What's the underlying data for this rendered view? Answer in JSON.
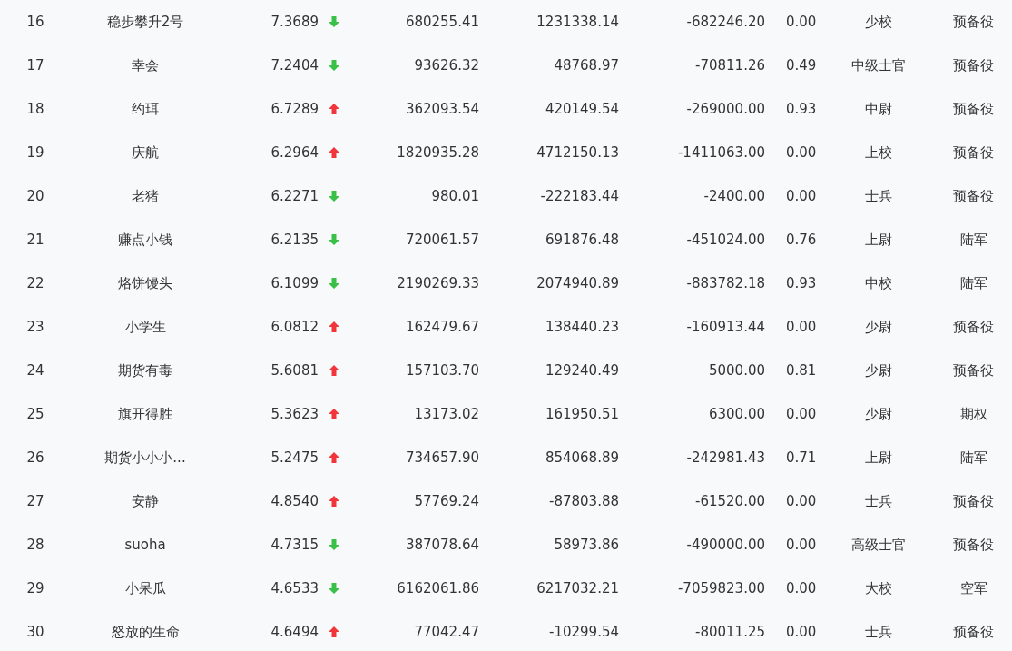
{
  "rows": [
    {
      "rank": "16",
      "name": "稳步攀升2号",
      "score": "7.3689",
      "rising": false,
      "column_4": "680255.41",
      "column_5": "1231338.14",
      "column_6": "-682246.20",
      "column_7": "0.00",
      "title": "少校",
      "group": "预备役"
    },
    {
      "rank": "17",
      "name": "幸会",
      "score": "7.2404",
      "rising": false,
      "column_4": "93626.32",
      "column_5": "48768.97",
      "column_6": "-70811.26",
      "column_7": "0.49",
      "title": "中级士官",
      "group": "预备役"
    },
    {
      "rank": "18",
      "name": "约珥",
      "score": "6.7289",
      "rising": true,
      "column_4": "362093.54",
      "column_5": "420149.54",
      "column_6": "-269000.00",
      "column_7": "0.93",
      "title": "中尉",
      "group": "预备役"
    },
    {
      "rank": "19",
      "name": "庆航",
      "score": "6.2964",
      "rising": true,
      "column_4": "1820935.28",
      "column_5": "4712150.13",
      "column_6": "-1411063.00",
      "column_7": "0.00",
      "title": "上校",
      "group": "预备役"
    },
    {
      "rank": "20",
      "name": "老猪",
      "score": "6.2271",
      "rising": false,
      "column_4": "980.01",
      "column_5": "-222183.44",
      "column_6": "-2400.00",
      "column_7": "0.00",
      "title": "士兵",
      "group": "预备役"
    },
    {
      "rank": "21",
      "name": "赚点小钱",
      "score": "6.2135",
      "rising": false,
      "column_4": "720061.57",
      "column_5": "691876.48",
      "column_6": "-451024.00",
      "column_7": "0.76",
      "title": "上尉",
      "group": "陆军"
    },
    {
      "rank": "22",
      "name": "烙饼馒头",
      "score": "6.1099",
      "rising": false,
      "column_4": "2190269.33",
      "column_5": "2074940.89",
      "column_6": "-883782.18",
      "column_7": "0.93",
      "title": "中校",
      "group": "陆军"
    },
    {
      "rank": "23",
      "name": "小学生",
      "score": "6.0812",
      "rising": true,
      "column_4": "162479.67",
      "column_5": "138440.23",
      "column_6": "-160913.44",
      "column_7": "0.00",
      "title": "少尉",
      "group": "预备役"
    },
    {
      "rank": "24",
      "name": "期货有毒",
      "score": "5.6081",
      "rising": true,
      "column_4": "157103.70",
      "column_5": "129240.49",
      "column_6": "5000.00",
      "column_7": "0.81",
      "title": "少尉",
      "group": "预备役"
    },
    {
      "rank": "25",
      "name": "旗开得胜",
      "score": "5.3623",
      "rising": true,
      "column_4": "13173.02",
      "column_5": "161950.51",
      "column_6": "6300.00",
      "column_7": "0.00",
      "title": "少尉",
      "group": "期权"
    },
    {
      "rank": "26",
      "name": "期货小小小...",
      "score": "5.2475",
      "rising": true,
      "column_4": "734657.90",
      "column_5": "854068.89",
      "column_6": "-242981.43",
      "column_7": "0.71",
      "title": "上尉",
      "group": "陆军"
    },
    {
      "rank": "27",
      "name": "安静",
      "score": "4.8540",
      "rising": true,
      "column_4": "57769.24",
      "column_5": "-87803.88",
      "column_6": "-61520.00",
      "column_7": "0.00",
      "title": "士兵",
      "group": "预备役"
    },
    {
      "rank": "28",
      "name": "suoha",
      "score": "4.7315",
      "rising": false,
      "column_4": "387078.64",
      "column_5": "58973.86",
      "column_6": "-490000.00",
      "column_7": "0.00",
      "title": "高级士官",
      "group": "预备役"
    },
    {
      "rank": "29",
      "name": "小呆瓜",
      "score": "4.6533",
      "rising": false,
      "column_4": "6162061.86",
      "column_5": "6217032.21",
      "column_6": "-7059823.00",
      "column_7": "0.00",
      "title": "大校",
      "group": "空军"
    },
    {
      "rank": "30",
      "name": "怒放的生命",
      "score": "4.6494",
      "rising": true,
      "column_4": "77042.47",
      "column_5": "-10299.54",
      "column_6": "-80011.25",
      "column_7": "0.00",
      "title": "士兵",
      "group": "预备役"
    }
  ]
}
